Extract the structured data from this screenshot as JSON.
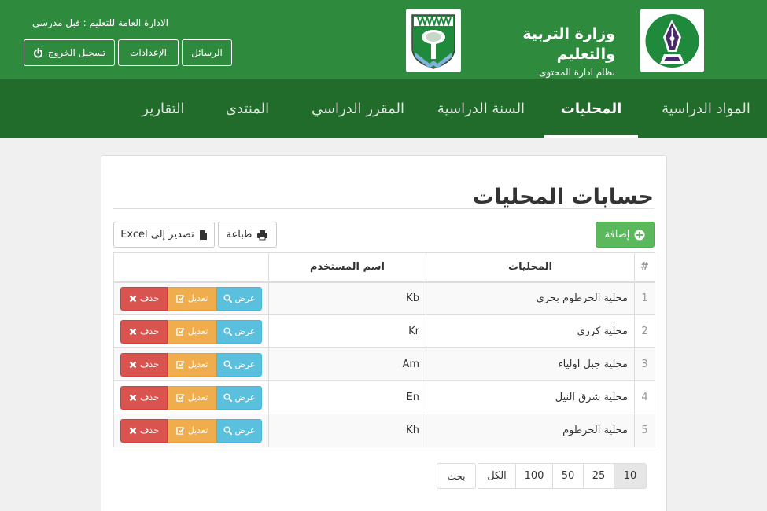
{
  "header": {
    "title": "وزارة التربية والتعليم",
    "subtitle": "نظام ادارة المحتوى",
    "admin_text": "الادارة العامة للتعليم : قبل مدرسي",
    "buttons": {
      "messages": "الرسائل",
      "settings": "الإعدادات",
      "logout": "تسجيل الخروج"
    }
  },
  "nav": {
    "items": [
      "المواد الدراسية",
      "المحليات",
      "السنة الدراسية",
      "المقرر الدراسي",
      "المنتدى",
      "التقارير"
    ],
    "active": "المحليات"
  },
  "page": {
    "title": "حسابات المحليات",
    "toolbar": {
      "add": "إضافة",
      "print": "طباعة",
      "export": "تصدير إلى Excel"
    }
  },
  "table": {
    "headers": [
      "#",
      "المحليات",
      "اسم المستخدم",
      ""
    ],
    "rows": [
      {
        "num": "1",
        "locality": "محلية الخرطوم بحري",
        "username": "Kb"
      },
      {
        "num": "2",
        "locality": "محلية كرري",
        "username": "Kr"
      },
      {
        "num": "3",
        "locality": "محلية جبل اولياء",
        "username": "Am"
      },
      {
        "num": "4",
        "locality": "محلية شرق النيل",
        "username": "En"
      },
      {
        "num": "5",
        "locality": "محلية الخرطوم",
        "username": "Kh"
      }
    ],
    "actions": {
      "view": "عرض",
      "edit": "تعديل",
      "delete": "حذف"
    }
  },
  "pagination": {
    "sizes": [
      "10",
      "25",
      "50",
      "100",
      "الكل"
    ],
    "selected": "10",
    "search": "بحث"
  },
  "colors": {
    "header_green": "#2e8b3e",
    "nav_green": "#216b2b",
    "success": "#5cb85c",
    "info": "#5bc0de",
    "warning": "#f0ad4e",
    "danger": "#d9534f"
  }
}
